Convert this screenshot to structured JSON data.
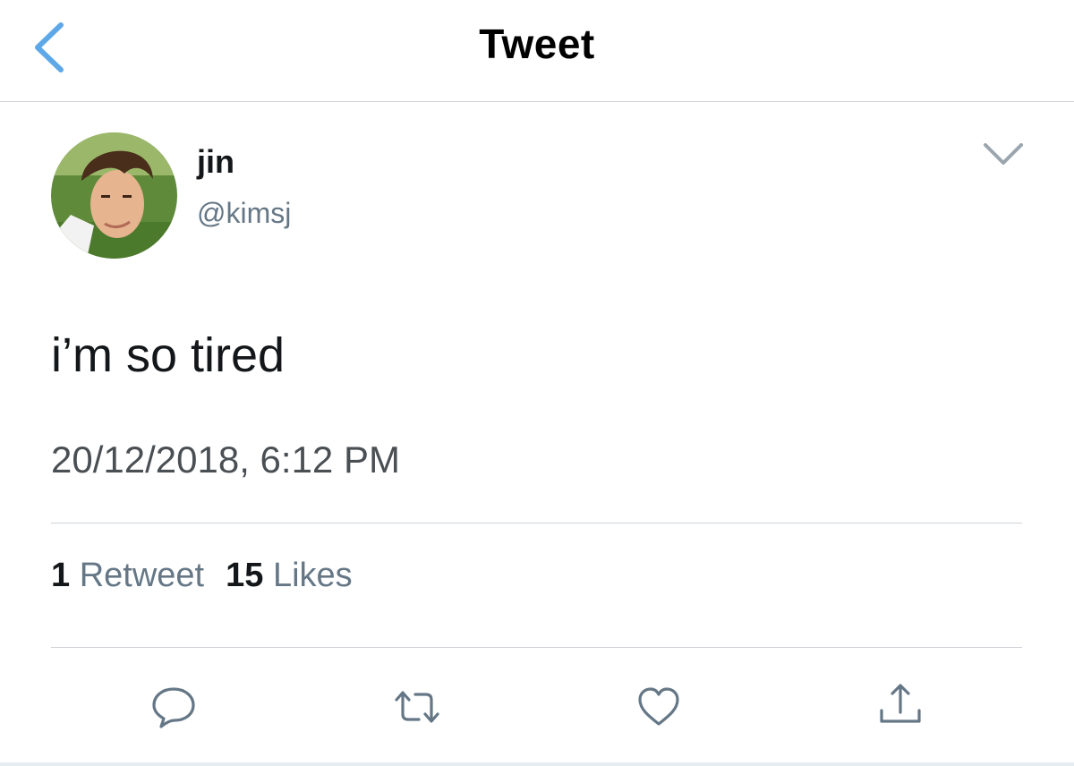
{
  "nav": {
    "title": "Tweet",
    "back_icon": "chevron-left-icon"
  },
  "author": {
    "display_name": "jin",
    "handle": "@kimsj",
    "avatar_icon": "avatar-photo"
  },
  "tweet": {
    "text": "i’m so tired",
    "timestamp": "20/12/2018, 6:12 PM"
  },
  "stats": {
    "retweet_count": "1",
    "retweet_label": "Retweet",
    "like_count": "15",
    "like_label": "Likes"
  },
  "actions": {
    "reply_icon": "reply-icon",
    "retweet_icon": "retweet-icon",
    "like_icon": "heart-icon",
    "share_icon": "share-icon"
  },
  "colors": {
    "accent": "#1da1f2",
    "back_chevron": "#5fa8e8",
    "secondary_text": "#657786",
    "icon_gray": "#657786",
    "divider": "#cfd4d9"
  }
}
